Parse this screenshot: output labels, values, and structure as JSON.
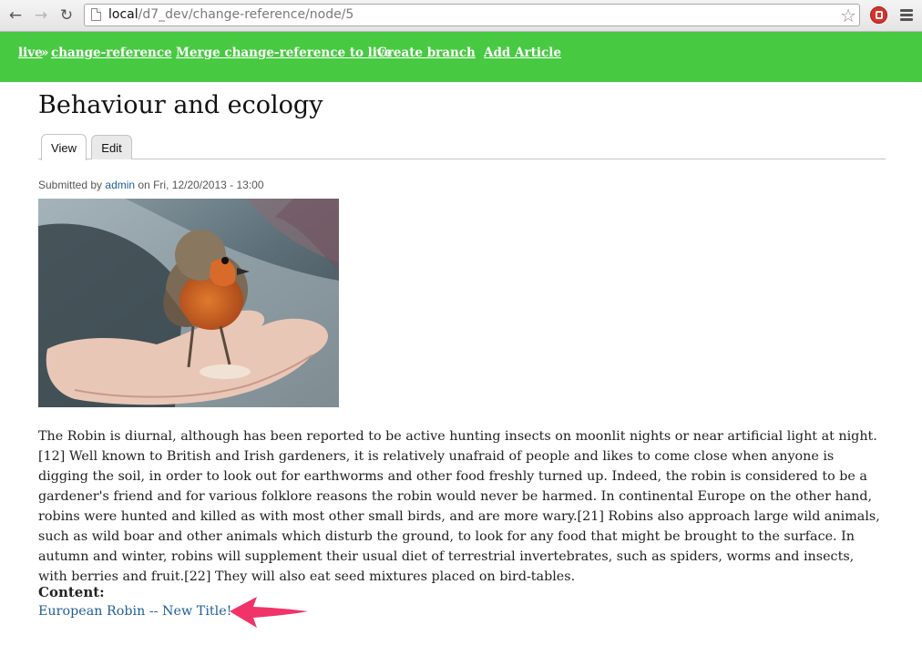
{
  "browser": {
    "url_host": "local",
    "url_path": "/d7_dev/change-reference/node/5",
    "back_icon": "arrow-left",
    "forward_icon": "arrow-right",
    "reload_icon": "reload",
    "bookmark_icon": "star-outline",
    "extension_icon": "red-stop-badge",
    "menu_icon": "hamburger"
  },
  "toolbar": {
    "background": "#47c941",
    "breadcrumb_live": "live",
    "breadcrumb_separator": "»",
    "breadcrumb_branch": "change-reference",
    "merge_link": "Merge change-reference to live",
    "create_branch_link": "Create branch",
    "add_article_link": "Add Article"
  },
  "page": {
    "title": "Behaviour and ecology",
    "tabs": [
      {
        "label": "View",
        "active": true
      },
      {
        "label": "Edit",
        "active": false
      }
    ],
    "submitted_prefix": "Submitted by",
    "submitted_author": "admin",
    "submitted_suffix": "on Fri, 12/20/2013 - 13:00",
    "image_subject": "robin perched on an outstretched hand",
    "body": "The Robin is diurnal, although has been reported to be active hunting insects on moonlit nights or near artificial light at night.[12] Well known to British and Irish gardeners, it is relatively unafraid of people and likes to come close when anyone is digging the soil, in order to look out for earthworms and other food freshly turned up. Indeed, the robin is considered to be a gardener's friend and for various folklore reasons the robin would never be harmed. In continental Europe on the other hand, robins were hunted and killed as with most other small birds, and are more wary.[21] Robins also approach large wild animals, such as wild boar and other animals which disturb the ground, to look for any food that might be brought to the surface. In autumn and winter, robins will supplement their usual diet of terrestrial invertebrates, such as spiders, worms and insects, with berries and fruit.[22] They will also eat seed mixtures placed on bird-tables.",
    "content_label": "Content:",
    "content_link": "European Robin -- New Title!",
    "annotation_color": "#f0346a",
    "link_color": "#1f5e9b"
  }
}
